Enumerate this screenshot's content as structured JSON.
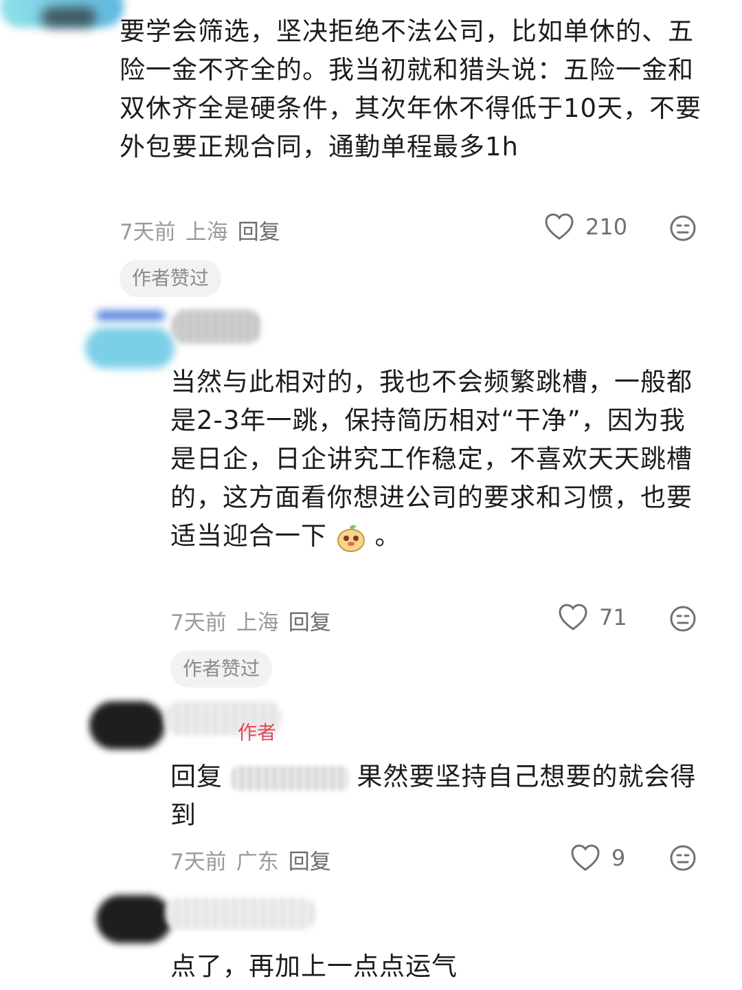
{
  "comments": [
    {
      "text": "要学会筛选，坚决拒绝不法公司，比如单休的、五险一金不齐全的。我当初就和猎头说：五险一金和双休齐全是硬条件，其次年休不得低于10天，不要外包要正规合同，通勤单程最多1h",
      "time": "7天前",
      "location": "上海",
      "reply_label": "回复",
      "likes": "210",
      "badge": "作者赞过"
    },
    {
      "text": "当然与此相对的，我也不会频繁跳槽，一般都是2-3年一跳，保持简历相对“干净”，因为我是日企，日企讲究工作稳定，不喜欢天天跳槽的，这方面看你想进公司的要求和习惯，也要适当迎合一下",
      "text_tail": "。",
      "time": "7天前",
      "location": "上海",
      "reply_label": "回复",
      "likes": "71",
      "badge": "作者赞过"
    },
    {
      "author_tag": "作者",
      "reply_prefix": "回复",
      "text": "果然要坚持自己想要的就会得到",
      "time": "7天前",
      "location": "广东",
      "reply_label": "回复",
      "likes": "9"
    },
    {
      "text": "点了，再加上一点点运气"
    }
  ],
  "icons": {
    "like": "heart-outline-icon",
    "dislike": "meh-face-icon",
    "sticker": "cartoon-face-sticker"
  },
  "colors": {
    "author_tag": "#e8485a",
    "badge_bg": "#f2f2f2"
  }
}
